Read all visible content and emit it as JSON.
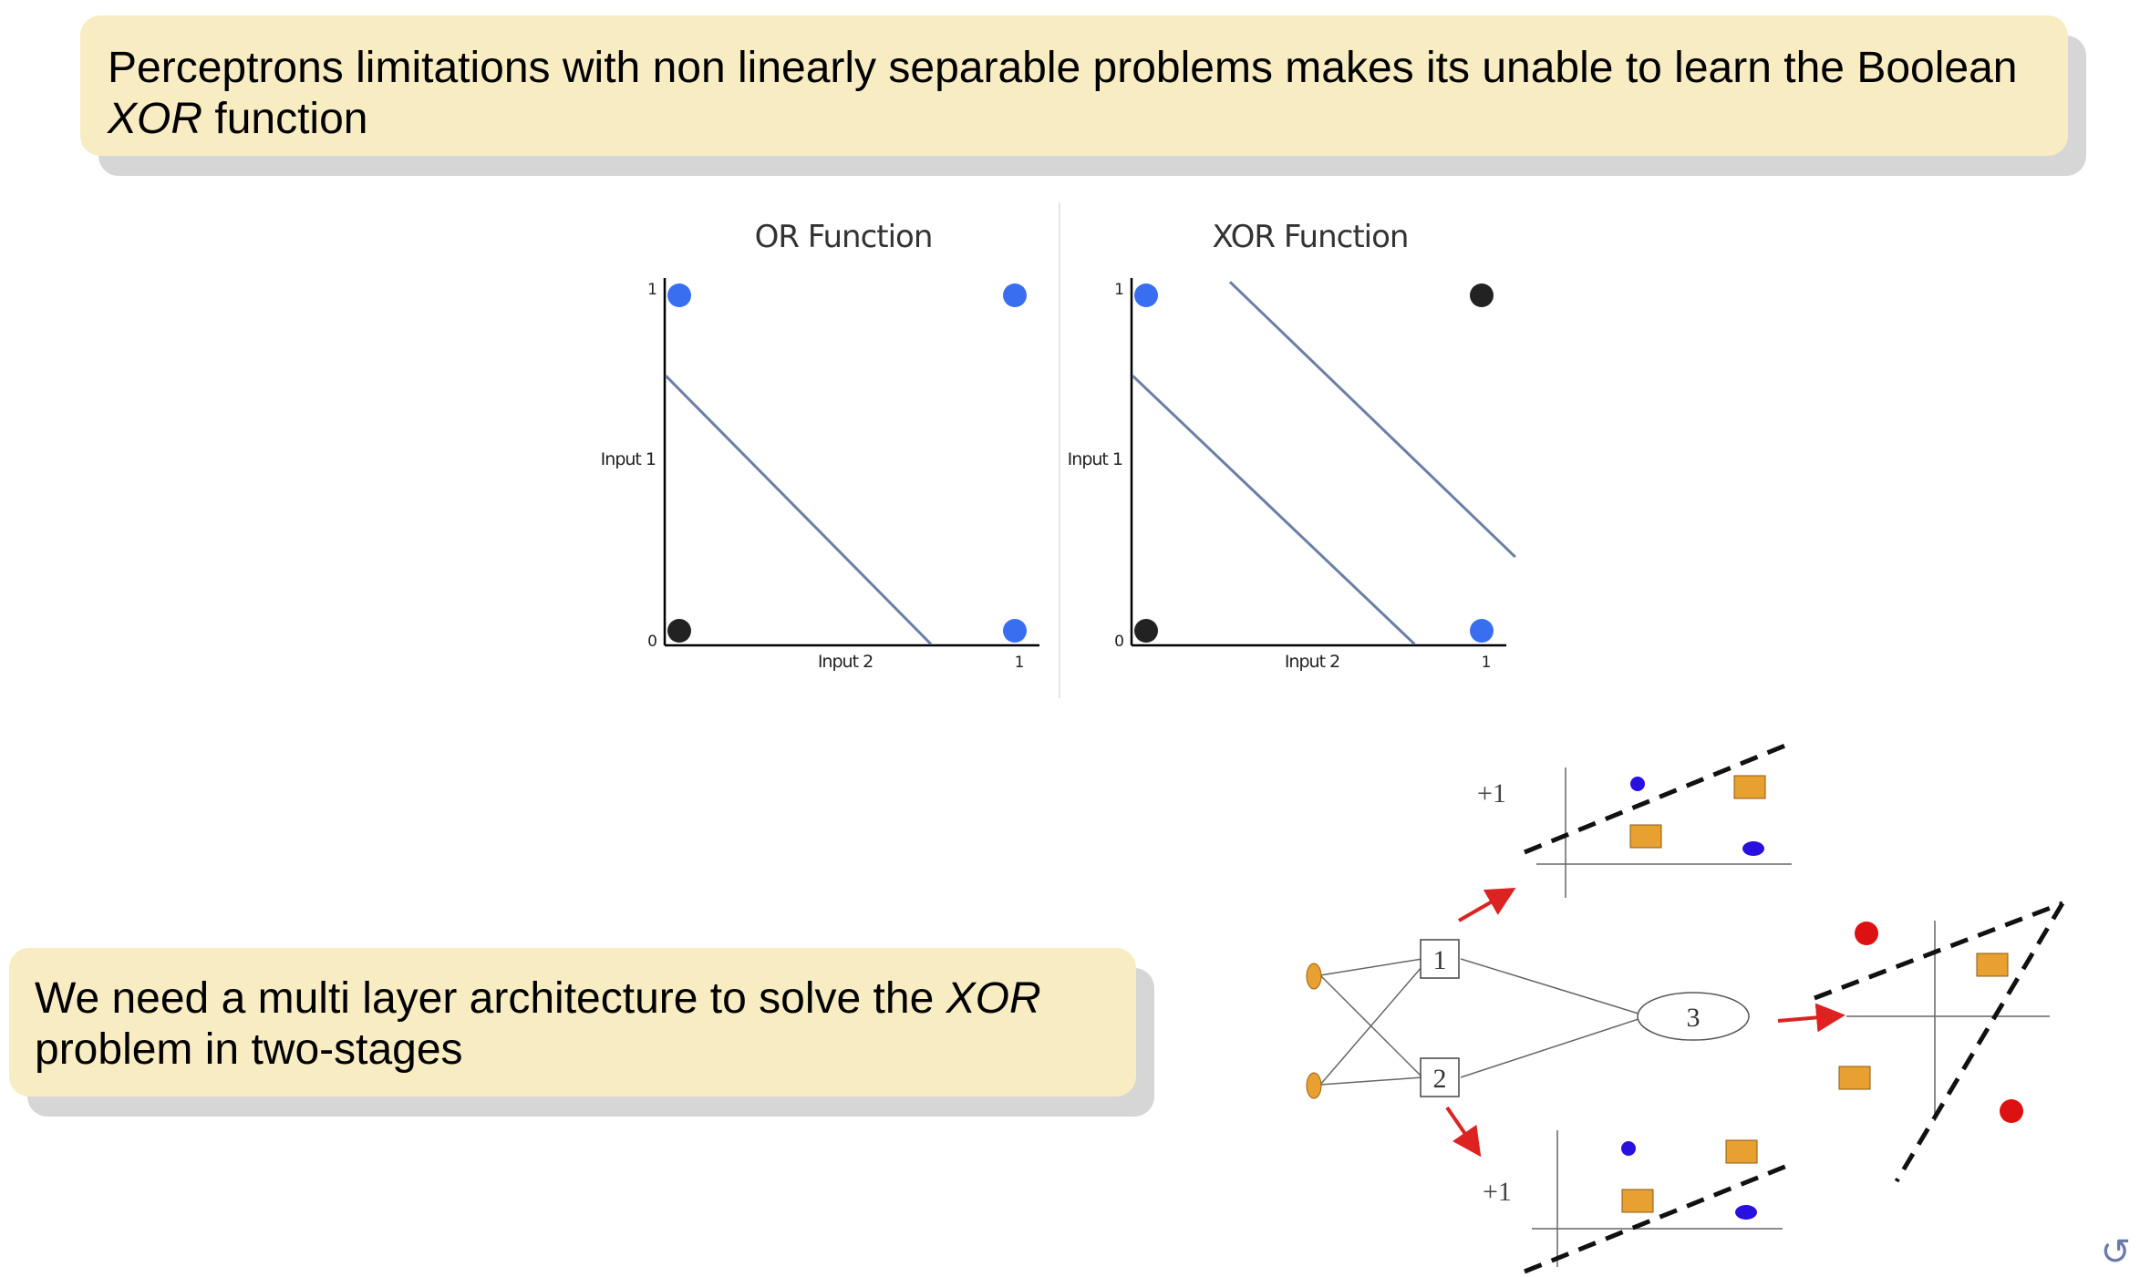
{
  "callouts": {
    "top": {
      "before": "Perceptrons limitations with non linearly separable problems makes its unable to learn the Boolean ",
      "em": "XOR",
      "after": " function"
    },
    "bottom": {
      "before": "We need a multi layer architecture to solve the ",
      "em": "XOR",
      "after": " problem in two-stages"
    }
  },
  "chart_data": [
    {
      "type": "scatter",
      "title": "OR Function",
      "xlabel": "Input 2",
      "ylabel": "Input 1",
      "xticks": [
        "0",
        "1"
      ],
      "yticks": [
        "0",
        "1"
      ],
      "xlim": [
        0,
        1
      ],
      "ylim": [
        0,
        1
      ],
      "points": [
        {
          "x": 0,
          "y": 1,
          "color": "#3a6ef0"
        },
        {
          "x": 1,
          "y": 1,
          "color": "#3a6ef0"
        },
        {
          "x": 0,
          "y": 0,
          "color": "#222222"
        },
        {
          "x": 1,
          "y": 0,
          "color": "#3a6ef0"
        }
      ],
      "lines": [
        {
          "from": [
            -0.04,
            0.76
          ],
          "to": [
            0.75,
            -0.04
          ]
        }
      ]
    },
    {
      "type": "scatter",
      "title": "XOR Function",
      "xlabel": "Input 2",
      "ylabel": "Input 1",
      "xticks": [
        "0",
        "1"
      ],
      "yticks": [
        "0",
        "1"
      ],
      "xlim": [
        0,
        1
      ],
      "ylim": [
        0,
        1
      ],
      "points": [
        {
          "x": 0,
          "y": 1,
          "color": "#3a6ef0"
        },
        {
          "x": 1,
          "y": 1,
          "color": "#222222"
        },
        {
          "x": 0,
          "y": 0,
          "color": "#222222"
        },
        {
          "x": 1,
          "y": 0,
          "color": "#3a6ef0"
        }
      ],
      "lines": [
        {
          "from": [
            -0.04,
            0.76
          ],
          "to": [
            0.8,
            -0.04
          ]
        },
        {
          "from": [
            0.25,
            1.04
          ],
          "to": [
            1.1,
            0.22
          ]
        }
      ]
    }
  ],
  "network": {
    "hidden_node_1": "1",
    "hidden_node_2": "2",
    "output_node": "3",
    "bias_label_top": "+1",
    "bias_label_bottom": "+1",
    "colors": {
      "input_node": "#e8a030",
      "square": "#e8a030",
      "blue_class": "#2a10e0",
      "red_class": "#dd1111",
      "arrow": "#dd2222"
    }
  },
  "footer": {
    "nav_icon": "undo-arrow-icon"
  }
}
